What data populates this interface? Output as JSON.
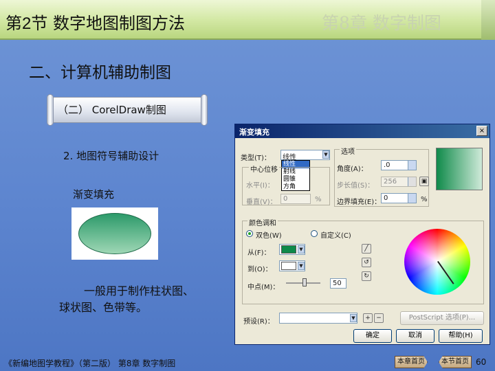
{
  "header": {
    "section_prefix": "第",
    "section_num": "2",
    "section_suffix": "节  数字地图制图方法",
    "chapter": "第8章  数字制图"
  },
  "heading": "二、计算机辅助制图",
  "scroll_label": "（二） CorelDraw制图",
  "subheading": "2. 地图符号辅助设计",
  "topic": "渐变填充",
  "description_line1": "一般用于制作柱状图、",
  "description_line2": "球状图、色带等。",
  "dialog": {
    "title": "渐变填充",
    "close": "×",
    "type_label": "类型(T)：",
    "type_value": "线性",
    "type_options": [
      "线性",
      "射线",
      "圆锥",
      "方角"
    ],
    "center_group": "中心位移",
    "horizontal_label": "水平(I)：",
    "vertical_label": "垂直(V)：",
    "vertical_value": "0",
    "percent": "%",
    "options_group": "选项",
    "angle_label": "角度(A)：",
    "angle_value": ".0",
    "steps_label": "步长值(S)：",
    "steps_value": "256",
    "edge_label": "边界填充(E)：",
    "edge_value": "0",
    "color_group": "颜色调和",
    "two_color": "双色(W)",
    "custom": "自定义(C)",
    "from_label": "从(F)：",
    "to_label": "到(O)：",
    "mid_label": "中点(M)：",
    "mid_value": "50",
    "preset_label": "预设(R)：",
    "postscript_button": "PostScript 选项(P)...",
    "ok": "确定",
    "cancel": "取消",
    "help": "帮助(H)",
    "colors": {
      "from": "#0e8a4a",
      "to": "#ffffff"
    }
  },
  "footer": {
    "book": "《新编地图学教程》（第二版） 第8章  数字制图",
    "btn_chapter_home": "本章首页",
    "btn_section_home": "本节首页",
    "page": "60"
  }
}
